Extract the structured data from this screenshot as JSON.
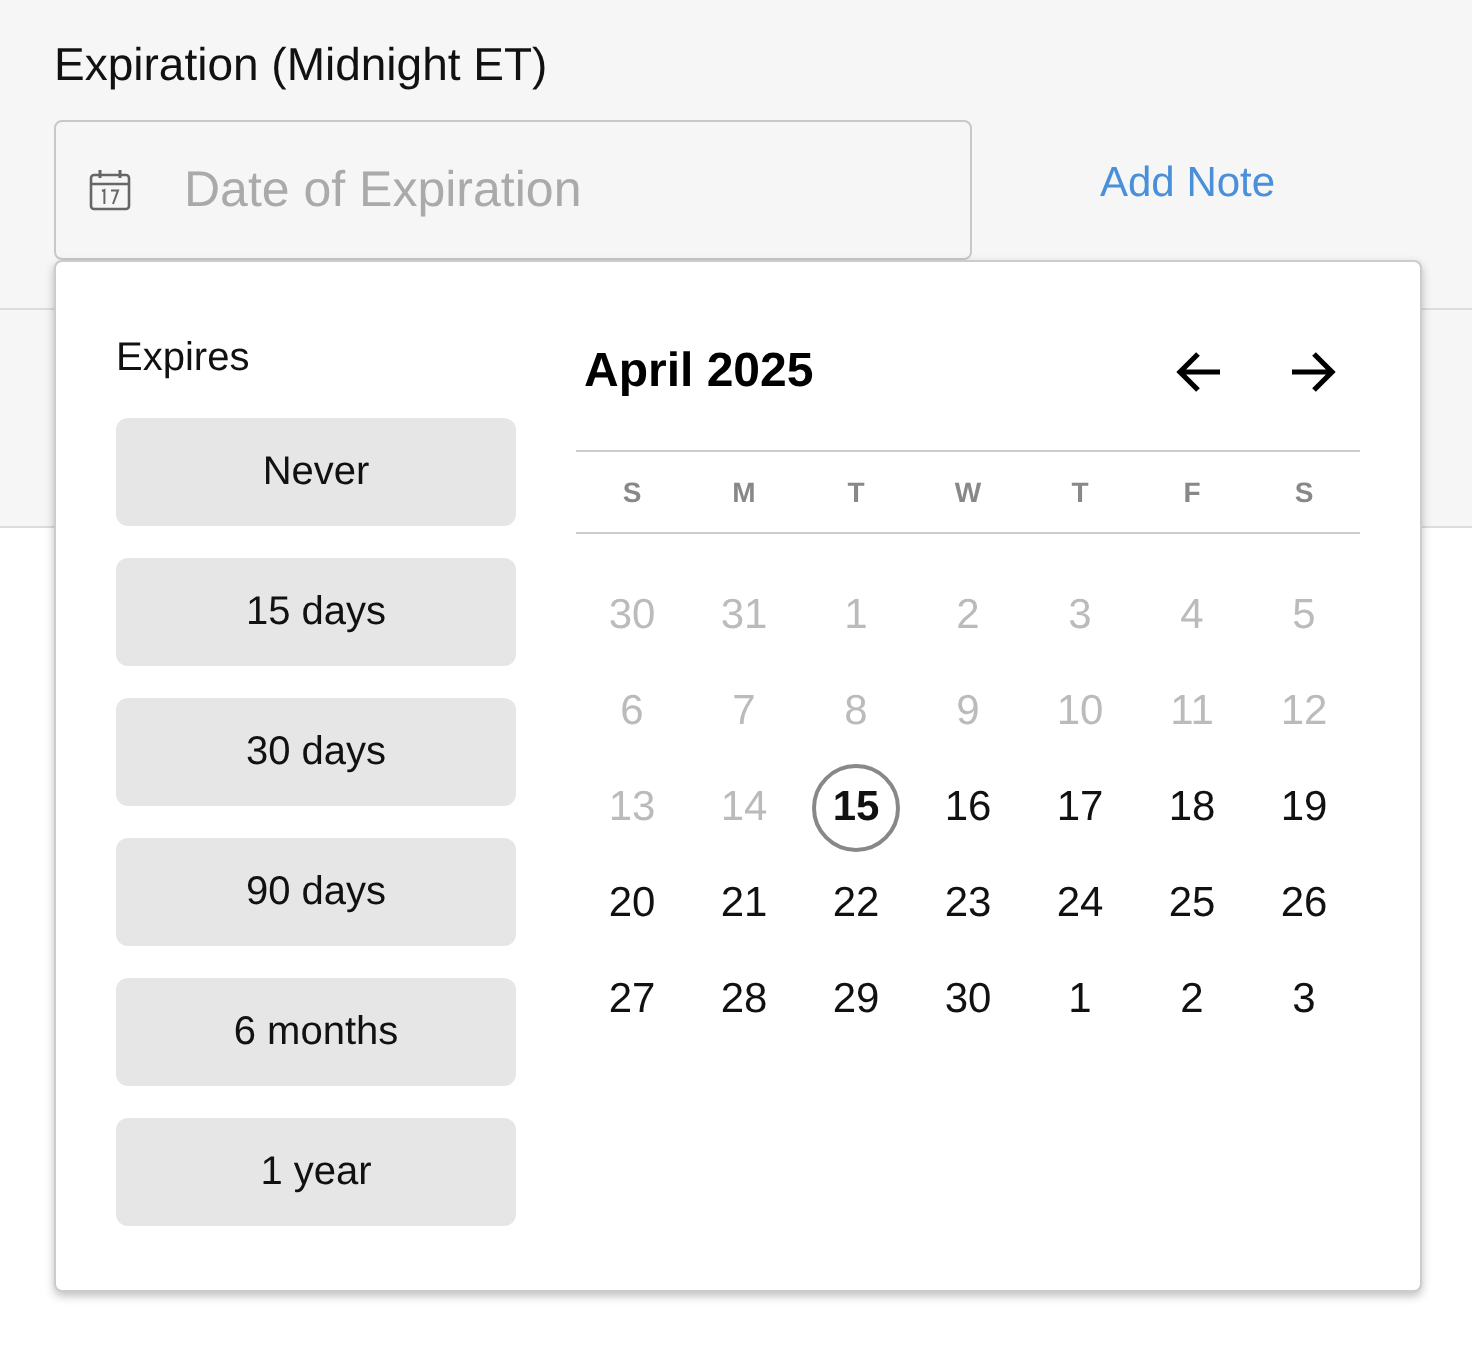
{
  "field_label": "Expiration (Midnight ET)",
  "date_field": {
    "placeholder": "Date of Expiration"
  },
  "add_note": "Add Note",
  "popup": {
    "expires_label": "Expires",
    "presets": [
      {
        "label": "Never"
      },
      {
        "label": "15 days"
      },
      {
        "label": "30 days"
      },
      {
        "label": "90 days"
      },
      {
        "label": "6 months"
      },
      {
        "label": "1 year"
      }
    ],
    "month_title": "April 2025",
    "weekdays": [
      "S",
      "M",
      "T",
      "W",
      "T",
      "F",
      "S"
    ],
    "days": [
      {
        "label": "30",
        "disabled": true,
        "today": false
      },
      {
        "label": "31",
        "disabled": true,
        "today": false
      },
      {
        "label": "1",
        "disabled": true,
        "today": false
      },
      {
        "label": "2",
        "disabled": true,
        "today": false
      },
      {
        "label": "3",
        "disabled": true,
        "today": false
      },
      {
        "label": "4",
        "disabled": true,
        "today": false
      },
      {
        "label": "5",
        "disabled": true,
        "today": false
      },
      {
        "label": "6",
        "disabled": true,
        "today": false
      },
      {
        "label": "7",
        "disabled": true,
        "today": false
      },
      {
        "label": "8",
        "disabled": true,
        "today": false
      },
      {
        "label": "9",
        "disabled": true,
        "today": false
      },
      {
        "label": "10",
        "disabled": true,
        "today": false
      },
      {
        "label": "11",
        "disabled": true,
        "today": false
      },
      {
        "label": "12",
        "disabled": true,
        "today": false
      },
      {
        "label": "13",
        "disabled": true,
        "today": false
      },
      {
        "label": "14",
        "disabled": true,
        "today": false
      },
      {
        "label": "15",
        "disabled": false,
        "today": true
      },
      {
        "label": "16",
        "disabled": false,
        "today": false
      },
      {
        "label": "17",
        "disabled": false,
        "today": false
      },
      {
        "label": "18",
        "disabled": false,
        "today": false
      },
      {
        "label": "19",
        "disabled": false,
        "today": false
      },
      {
        "label": "20",
        "disabled": false,
        "today": false
      },
      {
        "label": "21",
        "disabled": false,
        "today": false
      },
      {
        "label": "22",
        "disabled": false,
        "today": false
      },
      {
        "label": "23",
        "disabled": false,
        "today": false
      },
      {
        "label": "24",
        "disabled": false,
        "today": false
      },
      {
        "label": "25",
        "disabled": false,
        "today": false
      },
      {
        "label": "26",
        "disabled": false,
        "today": false
      },
      {
        "label": "27",
        "disabled": false,
        "today": false
      },
      {
        "label": "28",
        "disabled": false,
        "today": false
      },
      {
        "label": "29",
        "disabled": false,
        "today": false
      },
      {
        "label": "30",
        "disabled": false,
        "today": false
      },
      {
        "label": "1",
        "disabled": false,
        "today": false
      },
      {
        "label": "2",
        "disabled": false,
        "today": false
      },
      {
        "label": "3",
        "disabled": false,
        "today": false
      }
    ]
  }
}
